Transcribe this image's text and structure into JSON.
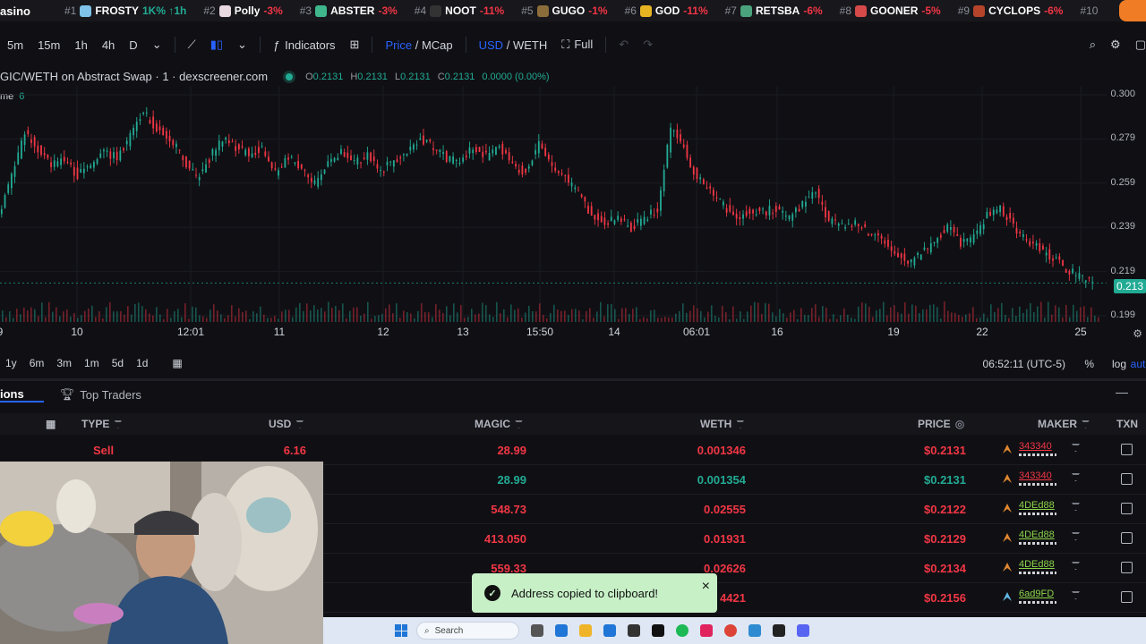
{
  "ticker": {
    "brand": "asino",
    "items": [
      {
        "rank": "#1",
        "name": "FROSTY",
        "change": "1K% ↑1h",
        "up": true,
        "logo_color": "#7fc3ea"
      },
      {
        "rank": "#2",
        "name": "Polly",
        "change": "-3%",
        "up": false,
        "logo_color": "#e8d8e0"
      },
      {
        "rank": "#3",
        "name": "ABSTER",
        "change": "-3%",
        "up": false,
        "logo_color": "#3fb68b"
      },
      {
        "rank": "#4",
        "name": "NOOT",
        "change": "-11%",
        "up": false,
        "logo_color": "#333333"
      },
      {
        "rank": "#5",
        "name": "GUGO",
        "change": "-1%",
        "up": false,
        "logo_color": "#8a6d3b"
      },
      {
        "rank": "#6",
        "name": "GOD",
        "change": "-11%",
        "up": false,
        "logo_color": "#e6b422"
      },
      {
        "rank": "#7",
        "name": "RETSBA",
        "change": "-6%",
        "up": false,
        "logo_color": "#4aa37c"
      },
      {
        "rank": "#8",
        "name": "GOONER",
        "change": "-5%",
        "up": false,
        "logo_color": "#d64a4a"
      },
      {
        "rank": "#9",
        "name": "CYCLOPS",
        "change": "-6%",
        "up": false,
        "logo_color": "#b5442b"
      },
      {
        "rank": "#10",
        "name": "",
        "change": "",
        "up": false,
        "logo_color": "#17171c"
      }
    ]
  },
  "toolbar": {
    "intervals": [
      "5m",
      "15m",
      "1h",
      "4h",
      "D"
    ],
    "indicators": "Indicators",
    "price": "Price",
    "slash": "/",
    "mcap": "MCap",
    "usd": "USD",
    "weth": "WETH",
    "full": "Full"
  },
  "chart": {
    "title": "GIC/WETH on Abstract Swap · 1 · dexscreener.com",
    "ohlc": {
      "o": "0.2131",
      "h": "0.2131",
      "l": "0.2131",
      "c": "0.2131",
      "change": "0.0000 (0.00%)"
    },
    "volume_label": "me",
    "volume_value": "6",
    "price_labels": [
      "0.300",
      "0.279",
      "0.259",
      "0.239",
      "0.219",
      "0.199"
    ],
    "last_price": "0.213",
    "time_labels": [
      "9",
      "10",
      "12:01",
      "11",
      "12",
      "13",
      "15:50",
      "14",
      "06:01",
      "16",
      "19",
      "22",
      "25"
    ]
  },
  "chart_data": {
    "type": "line",
    "title": "GIC/WETH on Abstract Swap · 1 · dexscreener.com",
    "ylim": [
      0.195,
      0.305
    ],
    "y": [
      0.245,
      0.262,
      0.283,
      0.276,
      0.268,
      0.271,
      0.263,
      0.268,
      0.274,
      0.272,
      0.281,
      0.293,
      0.285,
      0.281,
      0.271,
      0.262,
      0.271,
      0.281,
      0.276,
      0.273,
      0.276,
      0.265,
      0.272,
      0.265,
      0.26,
      0.268,
      0.275,
      0.27,
      0.272,
      0.266,
      0.27,
      0.273,
      0.28,
      0.277,
      0.271,
      0.269,
      0.276,
      0.272,
      0.277,
      0.268,
      0.265,
      0.278,
      0.267,
      0.262,
      0.255,
      0.245,
      0.241,
      0.243,
      0.238,
      0.244,
      0.247,
      0.285,
      0.276,
      0.262,
      0.256,
      0.249,
      0.243,
      0.247,
      0.246,
      0.248,
      0.243,
      0.25,
      0.256,
      0.242,
      0.239,
      0.242,
      0.236,
      0.233,
      0.228,
      0.222,
      0.227,
      0.232,
      0.24,
      0.231,
      0.234,
      0.245,
      0.248,
      0.24,
      0.233,
      0.229,
      0.225,
      0.22,
      0.216,
      0.213
    ],
    "ylabel": "",
    "xlabel": ""
  },
  "range_bar": {
    "ranges": [
      "1y",
      "6m",
      "3m",
      "1m",
      "5d",
      "1d"
    ],
    "clock": "06:52:11 (UTC-5)",
    "pct": "%",
    "log": "log",
    "auto": "auto"
  },
  "panel": {
    "tab_active": "ions",
    "tab_top_traders": "Top Traders"
  },
  "table": {
    "headers": {
      "type": "TYPE",
      "usd": "USD",
      "magic": "MAGIC",
      "weth": "WETH",
      "price": "PRICE",
      "maker": "MAKER",
      "txn": "TXN"
    },
    "rows": [
      {
        "type": "Sell",
        "usd": "6.16",
        "magic": "28.99",
        "weth": "0.001346",
        "price": "$0.2131",
        "maker": "343340",
        "side": "sell"
      },
      {
        "type": "",
        "usd": "",
        "magic": "28.99",
        "weth": "0.001354",
        "price": "$0.2131",
        "maker": "343340",
        "side": "buy"
      },
      {
        "type": "",
        "usd": "",
        "magic": "548.73",
        "weth": "0.02555",
        "price": "$0.2122",
        "maker": "4DEd88",
        "side": "sell"
      },
      {
        "type": "",
        "usd": "",
        "magic": "413.050",
        "weth": "0.01931",
        "price": "$0.2129",
        "maker": "4DEd88",
        "side": "sell"
      },
      {
        "type": "",
        "usd": "",
        "magic": "559.33",
        "weth": "0.02626",
        "price": "$0.2134",
        "maker": "4DEd88",
        "side": "sell"
      },
      {
        "type": "",
        "usd": "",
        "magic": "",
        "weth": "4421",
        "price": "$0.2156",
        "maker": "6ad9FD",
        "side": "sell"
      }
    ]
  },
  "toast": {
    "message": "Address copied to clipboard!"
  },
  "taskbar": {
    "search_placeholder": "Search"
  }
}
